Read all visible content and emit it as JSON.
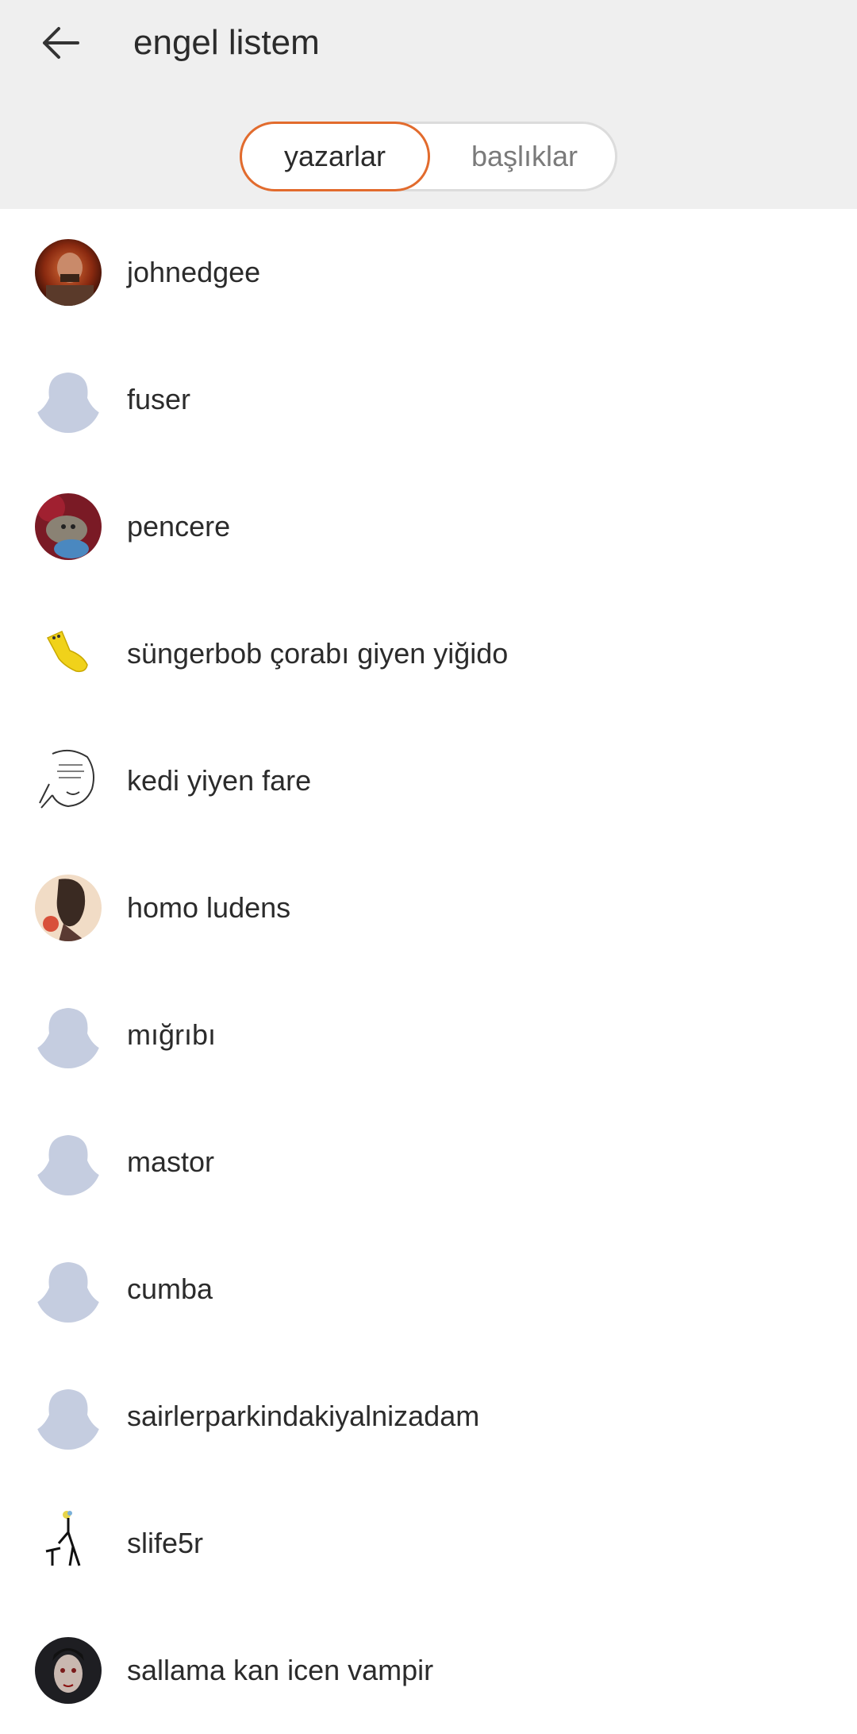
{
  "header": {
    "title": "engel listem",
    "back_icon": "arrow-left-icon"
  },
  "tabs": [
    {
      "label": "yazarlar",
      "active": true
    },
    {
      "label": "başlıklar",
      "active": false
    }
  ],
  "colors": {
    "accent": "#e26b2d",
    "header_bg": "#efefef",
    "placeholder_avatar": "#c5cde0"
  },
  "users": [
    {
      "name": "johnedgee",
      "avatar": "photo-avatar-man"
    },
    {
      "name": "fuser",
      "avatar": "default-avatar-icon"
    },
    {
      "name": "pencere",
      "avatar": "photo-avatar-cat"
    },
    {
      "name": "süngerbob çorabı giyen yiğido",
      "avatar": "sock-avatar"
    },
    {
      "name": "kedi yiyen fare",
      "avatar": "sketch-face-avatar"
    },
    {
      "name": "homo ludens",
      "avatar": "illustration-avatar"
    },
    {
      "name": "mığrıbı",
      "avatar": "default-avatar-icon"
    },
    {
      "name": "mastor",
      "avatar": "default-avatar-icon"
    },
    {
      "name": "cumba",
      "avatar": "default-avatar-icon"
    },
    {
      "name": "sairlerparkindakiyalnizadam",
      "avatar": "default-avatar-icon"
    },
    {
      "name": "slife5r",
      "avatar": "stick-figure-avatar"
    },
    {
      "name": "sallama kan icen vampir",
      "avatar": "photo-avatar-vampire"
    }
  ]
}
